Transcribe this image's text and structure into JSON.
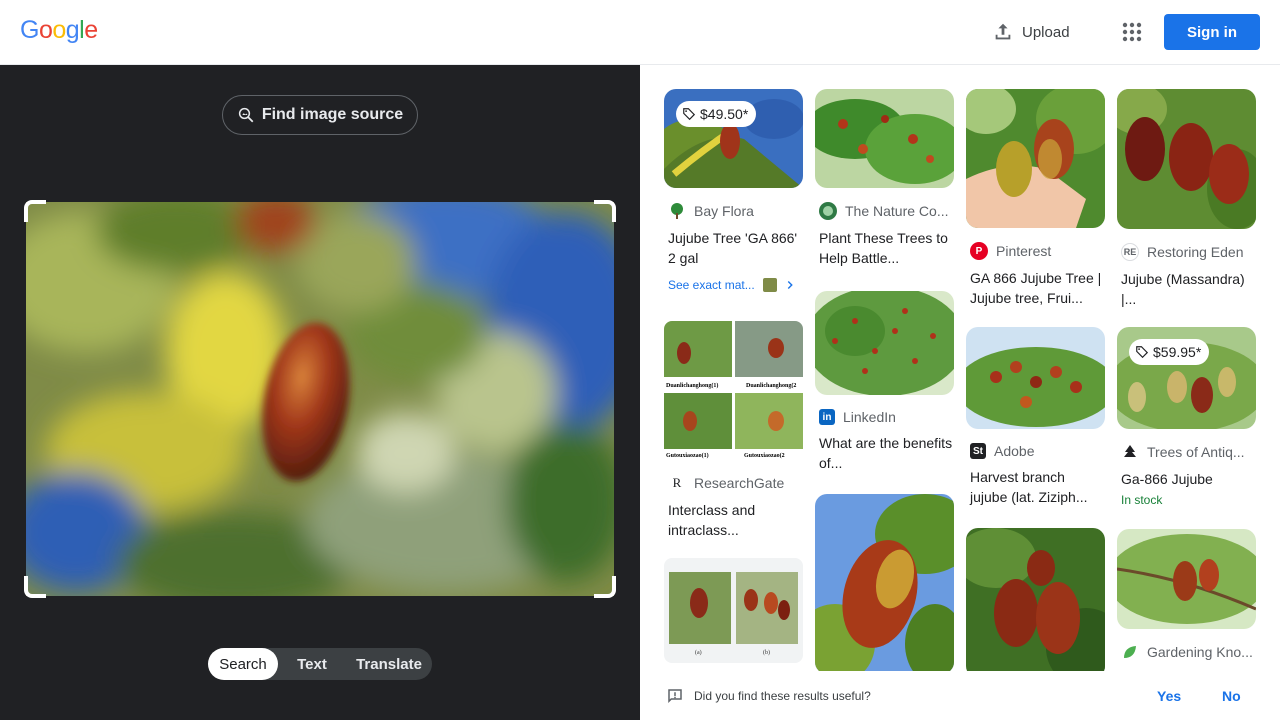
{
  "header": {
    "logo_letters": [
      "G",
      "o",
      "o",
      "g",
      "l",
      "e"
    ],
    "logo_colors": [
      "#4285F4",
      "#EA4335",
      "#FBBC05",
      "#4285F4",
      "#34A853",
      "#EA4335"
    ],
    "upload_label": "Upload",
    "apps_icon": "apps-grid-icon",
    "signin_label": "Sign in"
  },
  "left": {
    "find_source_label": "Find image source",
    "modes": [
      "Search",
      "Text",
      "Translate"
    ],
    "active_mode": "Search"
  },
  "results": [
    {
      "source": "Bay Flora",
      "title": "Jujube Tree 'GA 866' 2 gal",
      "price": "$49.50*",
      "exact_label": "See exact mat...",
      "icon": "tree-favicon"
    },
    {
      "source": "The Nature Co...",
      "title": "Plant These Trees to Help Battle...",
      "icon": "globe-favicon"
    },
    {
      "source": "Pinterest",
      "title": "GA 866 Jujube Tree | Jujube tree, Frui...",
      "icon": "pinterest-favicon"
    },
    {
      "source": "Restoring Eden",
      "title": "Jujube (Massandra) |...",
      "icon": "re-favicon"
    },
    {
      "source": "ResearchGate",
      "title": "Interclass and intraclass...",
      "icon": "researchgate-favicon",
      "panel_labels": [
        "Duanlichanghong(1)",
        "Duanlichanghong(2",
        "Gutouxiaozao(1)",
        "Gutouxiaozao(2"
      ]
    },
    {
      "source": "LinkedIn",
      "title": "What are the benefits of...",
      "icon": "linkedin-favicon"
    },
    {
      "source": "Adobe",
      "title": "Harvest branch jujube (lat. Ziziph...",
      "icon": "adobe-stock-favicon"
    },
    {
      "source": "Trees of Antiq...",
      "title": "Ga-866 Jujube",
      "price": "$59.95*",
      "stock": "In stock",
      "icon": "tree-favicon"
    },
    {
      "source": "Gardening Kno...",
      "icon": "leaf-favicon"
    },
    {
      "panel_labels": [
        "(a)",
        "(b)"
      ]
    }
  ],
  "feedback": {
    "question": "Did you find these results useful?",
    "yes": "Yes",
    "no": "No"
  }
}
